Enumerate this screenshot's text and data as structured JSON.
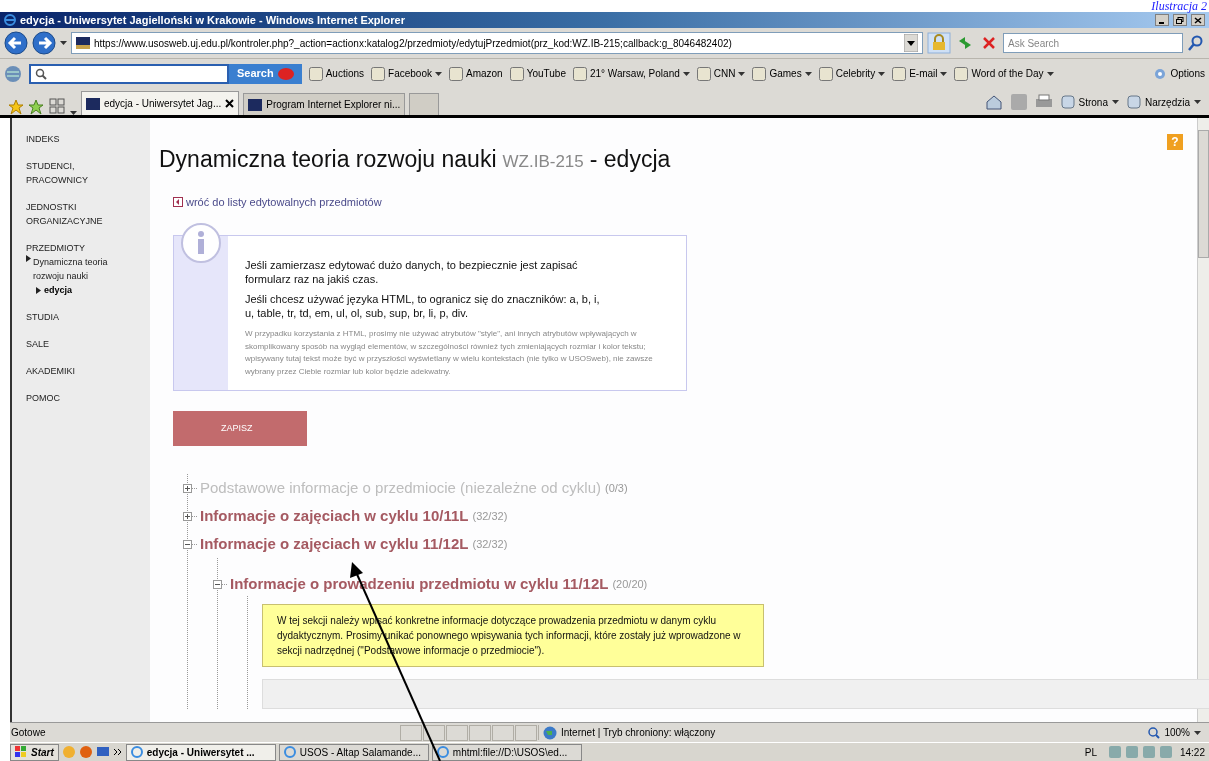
{
  "caption": "Ilustracja 2",
  "window": {
    "title": "edycja - Uniwersytet Jagielloński w Krakowie - Windows Internet Explorer"
  },
  "address_bar": {
    "url": "https://www.usosweb.uj.edu.pl/kontroler.php?_action=actionx:katalog2/przedmioty/edytujPrzedmiot(prz_kod:WZ.IB-215;callback:g_8046482402)",
    "search_placeholder": "Ask Search"
  },
  "search_toolbar": {
    "search_button": "Search",
    "items": [
      {
        "label": "Auctions",
        "menu": false
      },
      {
        "label": "Facebook",
        "menu": true
      },
      {
        "label": "Amazon",
        "menu": false
      },
      {
        "label": "YouTube",
        "menu": false
      },
      {
        "label": "21° Warsaw, Poland",
        "menu": true
      },
      {
        "label": "CNN",
        "menu": true
      },
      {
        "label": "Games",
        "menu": true
      },
      {
        "label": "Celebrity",
        "menu": true
      },
      {
        "label": "E-mail",
        "menu": true
      },
      {
        "label": "Word of the Day",
        "menu": true
      }
    ],
    "options": "Options"
  },
  "tabs": [
    {
      "label": "edycja - Uniwersytet Jag...",
      "selected": true
    },
    {
      "label": "Program Internet Explorer ni...",
      "selected": false
    }
  ],
  "command_bar": [
    "Strona",
    "Narzędzia"
  ],
  "sidebar": {
    "items": [
      {
        "label": "INDEKS"
      },
      {
        "label": "STUDENCI, PRACOWNICY"
      },
      {
        "label": "JEDNOSTKI ORGANIZACYJNE"
      },
      {
        "label": "PRZEDMIOTY",
        "children": [
          {
            "label": "Dynamiczna teoria rozwoju nauki",
            "selected": false,
            "children": [
              {
                "label": "edycja",
                "selected": true
              }
            ]
          }
        ]
      },
      {
        "label": "STUDIA"
      },
      {
        "label": "SALE"
      },
      {
        "label": "AKADEMIKI"
      },
      {
        "label": "POMOC"
      }
    ]
  },
  "page": {
    "title": "Dynamiczna teoria rozwoju nauki",
    "code": "WZ.IB-215",
    "title_suffix": "- edycja",
    "help": "?",
    "back_link": "wróć do listy edytowalnych przedmiotów",
    "info": [
      "Jeśli zamierzasz edytować dużo danych, to bezpiecznie jest zapisać formularz raz na jakiś czas.",
      "Jeśli chcesz używać języka HTML, to ogranicz się do znaczników: a, b, i, u, table, tr, td, em, ul, ol, sub, sup, br, li, p, div."
    ],
    "info_note": "W przypadku korzystania z HTML, prosimy nie używać atrybutów \"style\", ani innych atrybutów wpływających w skomplikowany sposób na wygląd elementów, w szczególności również tych zmieniających rozmiar i kolor tekstu; wpisywany tutaj tekst może być w przyszłości wyświetlany w wielu kontekstach (nie tylko w USOSweb), nie zawsze wybrany przez Ciebie rozmiar lub kolor będzie adekwatny.",
    "save_button": "ZAPISZ",
    "sections": [
      {
        "label": "Podstawowe informacje o przedmiocie (niezależne od cyklu)",
        "count": "(0/3)",
        "muted": true,
        "expanded": false
      },
      {
        "label": "Informacje o zajęciach w cyklu 10/11L",
        "count": "(32/32)",
        "muted": false,
        "expanded": false
      },
      {
        "label": "Informacje o zajęciach w cyklu 11/12L",
        "count": "(32/32)",
        "muted": false,
        "expanded": true,
        "children": [
          {
            "label": "Informacje o prowadzeniu przedmiotu w cyklu 11/12L",
            "count": "(20/20)",
            "muted": false,
            "expanded": true,
            "note": "W tej sekcji należy wpisać konkretne informacje dotyczące prowadzenia przedmiotu w danym cyklu dydaktycznym. Prosimy unikać ponownego wpisywania tych informacji, które zostały już wprowadzone w sekcji nadrzędnej (\"Podstawowe informacje o przedmiocie\")."
          }
        ]
      }
    ]
  },
  "status_bar": {
    "text": "Gotowe",
    "zone": "Internet | Tryb chroniony: włączony",
    "zoom": "100%"
  },
  "taskbar": {
    "start": "Start",
    "tasks": [
      {
        "label": "edycja - Uniwersytet ...",
        "selected": true
      },
      {
        "label": "USOS - Altap Salamande...",
        "selected": false
      },
      {
        "label": "mhtml:file://D:\\USOS\\ed...",
        "selected": false
      }
    ],
    "language": "PL",
    "clock": "14:22"
  }
}
